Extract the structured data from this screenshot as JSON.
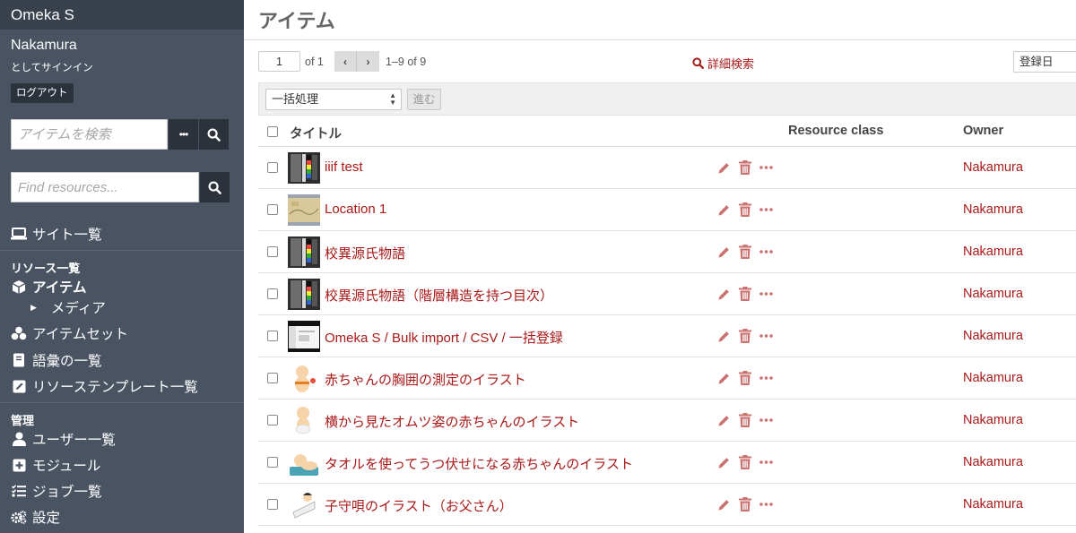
{
  "sidebar": {
    "brand": "Omeka S",
    "user_name": "Nakamura",
    "signed_in_as": "としてサインイン",
    "logout_label": "ログアウト",
    "search_items_placeholder": "アイテムを検索",
    "search_options_label": "•••",
    "find_resources_placeholder": "Find resources...",
    "sites_label": "サイト一覧",
    "resources_heading": "リソース一覧",
    "items_label": "アイテム",
    "media_label": "メディア",
    "item_sets_label": "アイテムセット",
    "vocabularies_label": "語彙の一覧",
    "templates_label": "リソーステンプレート一覧",
    "admin_heading": "管理",
    "users_label": "ユーザー一覧",
    "modules_label": "モジュール",
    "jobs_label": "ジョブ一覧",
    "settings_label": "設定"
  },
  "main": {
    "title": "アイテム",
    "page_number": "1",
    "page_of": "of 1",
    "row_count": "1–9 of 9",
    "advanced_search_label": "詳細検索",
    "sort_label": "登録日",
    "batch_select_label": "一括処理",
    "batch_go_label": "進む",
    "columns": {
      "title": "タイトル",
      "resource_class": "Resource class",
      "owner": "Owner"
    },
    "items": [
      {
        "title": "iiif test",
        "owner": "Nakamura",
        "thumb": "scan"
      },
      {
        "title": "Location 1",
        "owner": "Nakamura",
        "thumb": "map"
      },
      {
        "title": "校異源氏物語",
        "owner": "Nakamura",
        "thumb": "scan"
      },
      {
        "title": "校異源氏物語（階層構造を持つ目次）",
        "owner": "Nakamura",
        "thumb": "scan"
      },
      {
        "title": "Omeka S / Bulk import / CSV / 一括登録",
        "owner": "Nakamura",
        "thumb": "screenshot"
      },
      {
        "title": "赤ちゃんの胸囲の測定のイラスト",
        "owner": "Nakamura",
        "thumb": "baby"
      },
      {
        "title": "横から見たオムツ姿の赤ちゃんのイラスト",
        "owner": "Nakamura",
        "thumb": "baby-side"
      },
      {
        "title": "タオルを使ってうつ伏せになる赤ちゃんのイラスト",
        "owner": "Nakamura",
        "thumb": "baby-towel"
      },
      {
        "title": "子守唄のイラスト（お父さん）",
        "owner": "Nakamura",
        "thumb": "lullaby"
      }
    ]
  },
  "colors": {
    "sidebar_bg": "#495362",
    "brand_bg": "#39414d",
    "link": "#a91919",
    "action_icon": "#c9726f"
  },
  "icons": {
    "search": "search-icon",
    "edit": "pencil-icon",
    "delete": "trash-icon",
    "more": "ellipsis-icon",
    "sites": "laptop-icon",
    "items": "cube-icon",
    "item_sets": "cubes-icon",
    "vocabularies": "book-icon",
    "templates": "edit-square-icon",
    "users": "user-icon",
    "modules": "plus-square-icon",
    "jobs": "tasks-icon",
    "settings": "cogs-icon"
  }
}
